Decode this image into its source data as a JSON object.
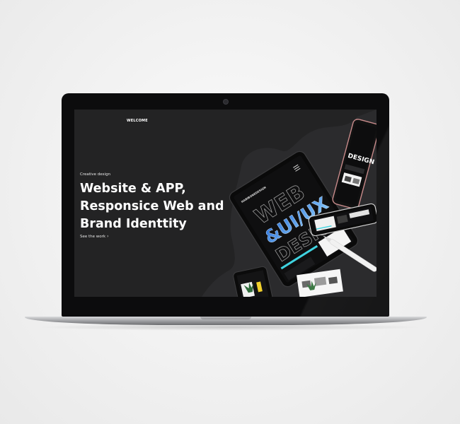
{
  "screen": {
    "nav_label": "WELCOME",
    "eyebrow": "Creative design",
    "headline_line1": "Website & APP,",
    "headline_line2": "Responsice Web and",
    "headline_line3": "Brand Identtity",
    "cta_label": "See the work",
    "cta_icon": "chevron-right-icon"
  },
  "mockup_art": {
    "tablet_logo": "HABIBONEDESIGN",
    "tablet_word1": "WEB",
    "tablet_word2": "&UI/UX",
    "tablet_word3": "DESIGN",
    "phone_word": "DESIGN"
  },
  "colors": {
    "page_background": "#f2f2f2",
    "screen_background": "#232324",
    "accent_cyan": "#3fd3e0",
    "accent_yellow": "#f2d12c",
    "accent_rose": "#c78a8a"
  }
}
